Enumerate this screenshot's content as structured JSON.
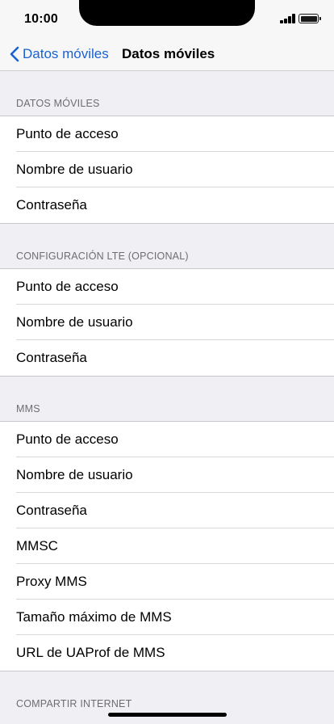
{
  "status": {
    "time": "10:00"
  },
  "nav": {
    "back_label": "Datos móviles",
    "title": "Datos móviles"
  },
  "sections": [
    {
      "header": "DATOS MÓVILES",
      "rows": [
        "Punto de acceso",
        "Nombre de usuario",
        "Contraseña"
      ]
    },
    {
      "header": "CONFIGURACIÓN LTE (OPCIONAL)",
      "rows": [
        "Punto de acceso",
        "Nombre de usuario",
        "Contraseña"
      ]
    },
    {
      "header": "MMS",
      "rows": [
        "Punto de acceso",
        "Nombre de usuario",
        "Contraseña",
        "MMSC",
        "Proxy MMS",
        "Tamaño máximo de MMS",
        "URL de UAProf de MMS"
      ]
    },
    {
      "header": "COMPARTIR INTERNET",
      "rows": []
    }
  ],
  "colors": {
    "accent": "#1a62d1",
    "background": "#efeff4"
  }
}
